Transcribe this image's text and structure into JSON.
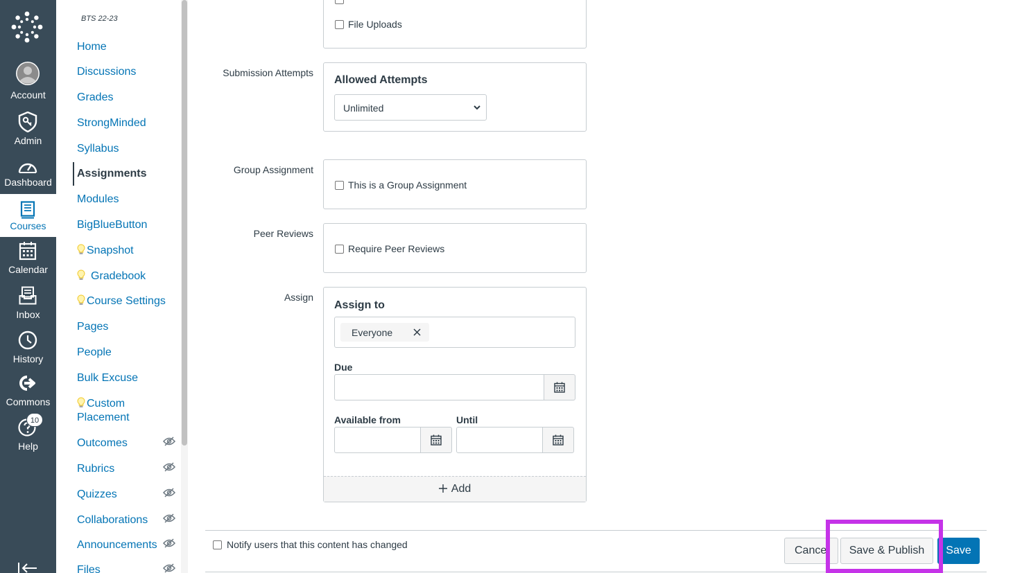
{
  "global_nav": {
    "items": [
      {
        "label": "Account",
        "icon": "account-avatar-icon"
      },
      {
        "label": "Admin",
        "icon": "admin-shield-icon"
      },
      {
        "label": "Dashboard",
        "icon": "dashboard-gauge-icon"
      },
      {
        "label": "Courses",
        "icon": "courses-book-icon",
        "active": true
      },
      {
        "label": "Calendar",
        "icon": "calendar-icon"
      },
      {
        "label": "Inbox",
        "icon": "inbox-icon"
      },
      {
        "label": "History",
        "icon": "history-clock-icon"
      },
      {
        "label": "Commons",
        "icon": "commons-icon"
      },
      {
        "label": "Help",
        "icon": "help-icon",
        "badge": "10"
      }
    ],
    "accent": "#394b58"
  },
  "course_nav": {
    "breadcrumb": "BTS 22-23",
    "items": [
      {
        "label": "Home"
      },
      {
        "label": "Discussions"
      },
      {
        "label": "Grades"
      },
      {
        "label": "StrongMinded"
      },
      {
        "label": "Syllabus"
      },
      {
        "label": "Assignments",
        "active": true
      },
      {
        "label": "Modules"
      },
      {
        "label": "BigBlueButton"
      },
      {
        "label": "Snapshot",
        "bulb": true
      },
      {
        "label": "Gradebook",
        "bulb": true
      },
      {
        "label": "Course Settings",
        "bulb": true
      },
      {
        "label": "Pages"
      },
      {
        "label": "People"
      },
      {
        "label": "Bulk Excuse"
      },
      {
        "label": "Custom Placement",
        "bulb": true
      },
      {
        "label": "Outcomes",
        "hidden": true
      },
      {
        "label": "Rubrics",
        "hidden": true
      },
      {
        "label": "Quizzes",
        "hidden": true
      },
      {
        "label": "Collaborations",
        "hidden": true
      },
      {
        "label": "Announcements",
        "hidden": true
      },
      {
        "label": "Files",
        "hidden": true
      }
    ],
    "link_color": "#0374b5"
  },
  "form": {
    "file_uploads_label": "File Uploads",
    "submission_attempts": {
      "row_label": "Submission Attempts",
      "title": "Allowed Attempts",
      "selected": "Unlimited"
    },
    "group_assignment": {
      "row_label": "Group Assignment",
      "checkbox_label": "This is a Group Assignment"
    },
    "peer_reviews": {
      "row_label": "Peer Reviews",
      "checkbox_label": "Require Peer Reviews"
    },
    "assign": {
      "row_label": "Assign",
      "title": "Assign to",
      "token": "Everyone",
      "due_label": "Due",
      "available_from_label": "Available from",
      "until_label": "Until",
      "add_label": "Add"
    }
  },
  "footer": {
    "notify_label": "Notify users that this content has changed",
    "cancel_label": "Cancel",
    "save_publish_label": "Save & Publish",
    "save_label": "Save",
    "primary_color": "#0374b5",
    "highlight_color": "#c533e8"
  }
}
